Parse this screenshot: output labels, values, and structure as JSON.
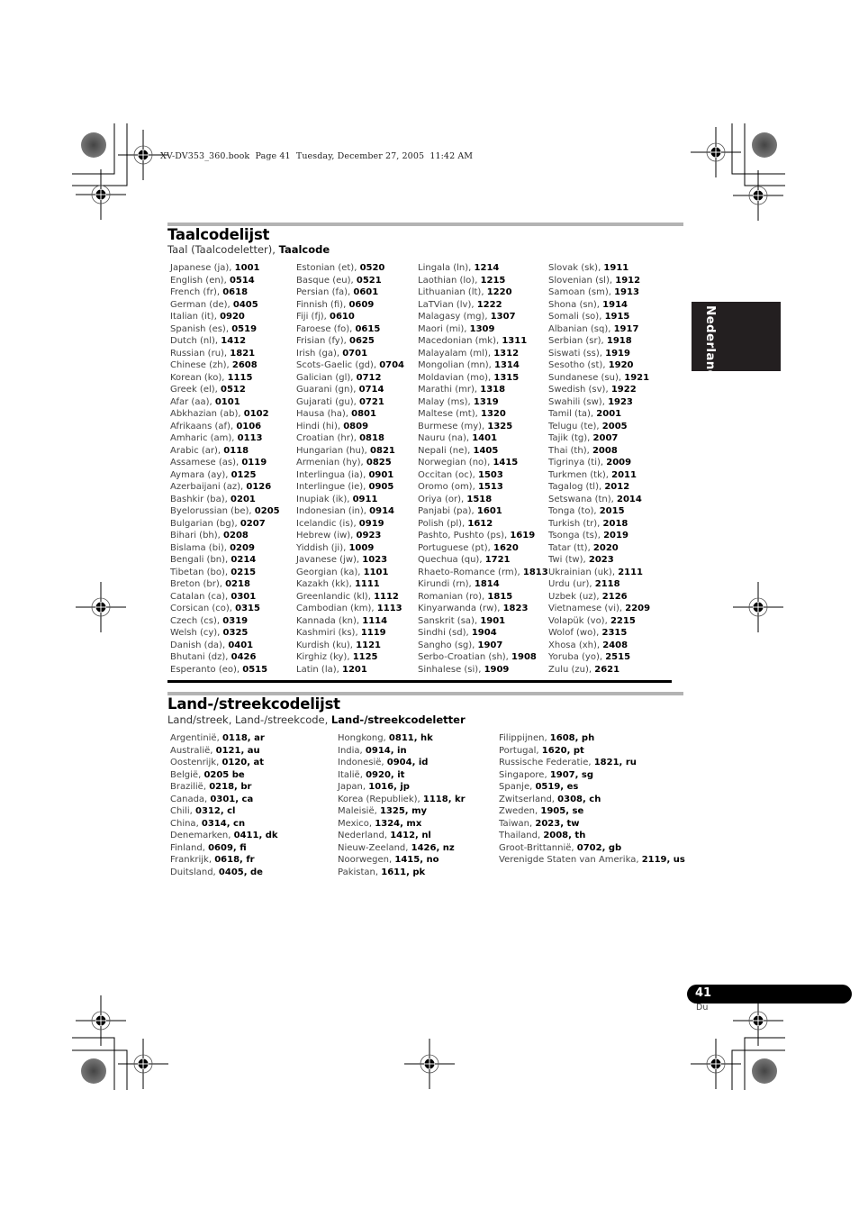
{
  "print_header": "XV-DV353_360.book  Page 41  Tuesday, December 27, 2005  11:42 AM",
  "side_tab": {
    "label": "Nederlands"
  },
  "language_section": {
    "title": "Taalcodelijst",
    "subtitle_plain": "Taal (Taalcodeletter), ",
    "subtitle_bold": "Taalcode",
    "columns": [
      [
        {
          "name": "Japanese (ja), ",
          "code": "1001"
        },
        {
          "name": "English (en), ",
          "code": "0514"
        },
        {
          "name": "French (fr), ",
          "code": "0618"
        },
        {
          "name": "German (de), ",
          "code": "0405"
        },
        {
          "name": "Italian (it), ",
          "code": "0920"
        },
        {
          "name": "Spanish (es), ",
          "code": "0519"
        },
        {
          "name": "Dutch (nl), ",
          "code": "1412"
        },
        {
          "name": "Russian (ru), ",
          "code": "1821"
        },
        {
          "name": "Chinese (zh), ",
          "code": "2608"
        },
        {
          "name": "Korean (ko), ",
          "code": "1115"
        },
        {
          "name": "Greek (el), ",
          "code": "0512"
        },
        {
          "name": "Afar (aa), ",
          "code": "0101"
        },
        {
          "name": "Abkhazian (ab), ",
          "code": "0102"
        },
        {
          "name": "Afrikaans (af), ",
          "code": "0106"
        },
        {
          "name": "Amharic (am), ",
          "code": "0113"
        },
        {
          "name": "Arabic (ar), ",
          "code": "0118"
        },
        {
          "name": "Assamese (as), ",
          "code": "0119"
        },
        {
          "name": "Aymara (ay), ",
          "code": "0125"
        },
        {
          "name": "Azerbaijani (az), ",
          "code": "0126"
        },
        {
          "name": "Bashkir (ba), ",
          "code": "0201"
        },
        {
          "name": "Byelorussian (be), ",
          "code": "0205"
        },
        {
          "name": "Bulgarian (bg), ",
          "code": "0207"
        },
        {
          "name": "Bihari (bh), ",
          "code": "0208"
        },
        {
          "name": "Bislama (bi), ",
          "code": "0209"
        },
        {
          "name": "Bengali (bn), ",
          "code": "0214"
        },
        {
          "name": "Tibetan (bo), ",
          "code": "0215"
        },
        {
          "name": "Breton (br), ",
          "code": "0218"
        },
        {
          "name": "Catalan (ca), ",
          "code": "0301"
        },
        {
          "name": "Corsican (co), ",
          "code": "0315"
        },
        {
          "name": "Czech (cs), ",
          "code": "0319"
        },
        {
          "name": "Welsh (cy), ",
          "code": "0325"
        },
        {
          "name": "Danish (da), ",
          "code": "0401"
        },
        {
          "name": "Bhutani (dz), ",
          "code": "0426"
        },
        {
          "name": "Esperanto (eo), ",
          "code": "0515"
        }
      ],
      [
        {
          "name": "Estonian (et), ",
          "code": "0520"
        },
        {
          "name": "Basque (eu), ",
          "code": "0521"
        },
        {
          "name": "Persian (fa), ",
          "code": "0601"
        },
        {
          "name": "Finnish (fi), ",
          "code": "0609"
        },
        {
          "name": "Fiji (fj), ",
          "code": "0610"
        },
        {
          "name": "Faroese (fo), ",
          "code": "0615"
        },
        {
          "name": "Frisian (fy), ",
          "code": "0625"
        },
        {
          "name": "Irish (ga), ",
          "code": "0701"
        },
        {
          "name": "Scots-Gaelic (gd), ",
          "code": "0704"
        },
        {
          "name": "Galician (gl), ",
          "code": "0712"
        },
        {
          "name": "Guarani (gn), ",
          "code": "0714"
        },
        {
          "name": "Gujarati (gu), ",
          "code": "0721"
        },
        {
          "name": "Hausa (ha), ",
          "code": "0801"
        },
        {
          "name": "Hindi (hi), ",
          "code": "0809"
        },
        {
          "name": "Croatian (hr), ",
          "code": "0818"
        },
        {
          "name": "Hungarian (hu), ",
          "code": "0821"
        },
        {
          "name": "Armenian (hy), ",
          "code": "0825"
        },
        {
          "name": "Interlingua (ia), ",
          "code": "0901"
        },
        {
          "name": "Interlingue (ie), ",
          "code": "0905"
        },
        {
          "name": "Inupiak (ik), ",
          "code": "0911"
        },
        {
          "name": "Indonesian (in), ",
          "code": "0914"
        },
        {
          "name": "Icelandic (is), ",
          "code": "0919"
        },
        {
          "name": "Hebrew (iw), ",
          "code": "0923"
        },
        {
          "name": "Yiddish (ji), ",
          "code": "1009"
        },
        {
          "name": "Javanese (jw), ",
          "code": "1023"
        },
        {
          "name": "Georgian (ka), ",
          "code": "1101"
        },
        {
          "name": "Kazakh (kk), ",
          "code": "1111"
        },
        {
          "name": "Greenlandic (kl), ",
          "code": "1112"
        },
        {
          "name": "Cambodian (km), ",
          "code": "1113"
        },
        {
          "name": "Kannada (kn), ",
          "code": "1114"
        },
        {
          "name": "Kashmiri (ks), ",
          "code": "1119"
        },
        {
          "name": "Kurdish (ku), ",
          "code": "1121"
        },
        {
          "name": "Kirghiz (ky), ",
          "code": "1125"
        },
        {
          "name": "Latin (la), ",
          "code": "1201"
        }
      ],
      [
        {
          "name": "Lingala (ln), ",
          "code": "1214"
        },
        {
          "name": "Laothian (lo), ",
          "code": "1215"
        },
        {
          "name": "Lithuanian (lt), ",
          "code": "1220"
        },
        {
          "name": "LaTVian (lv), ",
          "code": "1222"
        },
        {
          "name": "Malagasy (mg), ",
          "code": "1307"
        },
        {
          "name": "Maori (mi), ",
          "code": "1309"
        },
        {
          "name": "Macedonian (mk), ",
          "code": "1311"
        },
        {
          "name": "Malayalam (ml), ",
          "code": "1312"
        },
        {
          "name": "Mongolian (mn), ",
          "code": "1314"
        },
        {
          "name": "Moldavian (mo), ",
          "code": "1315"
        },
        {
          "name": "Marathi (mr), ",
          "code": "1318"
        },
        {
          "name": "Malay (ms), ",
          "code": "1319"
        },
        {
          "name": "Maltese (mt), ",
          "code": "1320"
        },
        {
          "name": "Burmese (my), ",
          "code": "1325"
        },
        {
          "name": "Nauru (na), ",
          "code": "1401"
        },
        {
          "name": "Nepali (ne), ",
          "code": "1405"
        },
        {
          "name": "Norwegian (no), ",
          "code": "1415"
        },
        {
          "name": "Occitan (oc), ",
          "code": "1503"
        },
        {
          "name": "Oromo (om), ",
          "code": "1513"
        },
        {
          "name": "Oriya (or), ",
          "code": "1518"
        },
        {
          "name": "Panjabi (pa), ",
          "code": "1601"
        },
        {
          "name": "Polish (pl), ",
          "code": "1612"
        },
        {
          "name": "Pashto, Pushto (ps), ",
          "code": "1619"
        },
        {
          "name": "Portuguese (pt), ",
          "code": "1620"
        },
        {
          "name": "Quechua (qu), ",
          "code": "1721"
        },
        {
          "name": "Rhaeto-Romance (rm), ",
          "code": "1813"
        },
        {
          "name": "Kirundi (rn), ",
          "code": "1814"
        },
        {
          "name": "Romanian (ro), ",
          "code": "1815"
        },
        {
          "name": "Kinyarwanda (rw), ",
          "code": "1823"
        },
        {
          "name": "Sanskrit (sa), ",
          "code": "1901"
        },
        {
          "name": "Sindhi (sd), ",
          "code": "1904"
        },
        {
          "name": "Sangho (sg), ",
          "code": "1907"
        },
        {
          "name": "Serbo-Croatian (sh), ",
          "code": "1908"
        },
        {
          "name": "Sinhalese (si), ",
          "code": "1909"
        }
      ],
      [
        {
          "name": "Slovak (sk), ",
          "code": "1911"
        },
        {
          "name": "Slovenian (sl), ",
          "code": "1912"
        },
        {
          "name": "Samoan (sm), ",
          "code": "1913"
        },
        {
          "name": "Shona (sn), ",
          "code": "1914"
        },
        {
          "name": "Somali (so), ",
          "code": "1915"
        },
        {
          "name": "Albanian (sq), ",
          "code": "1917"
        },
        {
          "name": "Serbian (sr), ",
          "code": "1918"
        },
        {
          "name": "Siswati (ss), ",
          "code": "1919"
        },
        {
          "name": "Sesotho (st), ",
          "code": "1920"
        },
        {
          "name": "Sundanese (su), ",
          "code": "1921"
        },
        {
          "name": "Swedish (sv), ",
          "code": "1922"
        },
        {
          "name": "Swahili (sw), ",
          "code": "1923"
        },
        {
          "name": "Tamil (ta), ",
          "code": "2001"
        },
        {
          "name": "Telugu (te), ",
          "code": "2005"
        },
        {
          "name": "Tajik (tg), ",
          "code": "2007"
        },
        {
          "name": "Thai (th), ",
          "code": "2008"
        },
        {
          "name": "Tigrinya (ti), ",
          "code": "2009"
        },
        {
          "name": "Turkmen (tk), ",
          "code": "2011"
        },
        {
          "name": "Tagalog (tl), ",
          "code": "2012"
        },
        {
          "name": "Setswana (tn), ",
          "code": "2014"
        },
        {
          "name": "Tonga (to), ",
          "code": "2015"
        },
        {
          "name": "Turkish (tr), ",
          "code": "2018"
        },
        {
          "name": "Tsonga (ts), ",
          "code": "2019"
        },
        {
          "name": "Tatar (tt), ",
          "code": "2020"
        },
        {
          "name": "Twi (tw), ",
          "code": "2023"
        },
        {
          "name": "Ukrainian (uk), ",
          "code": "2111"
        },
        {
          "name": "Urdu (ur), ",
          "code": "2118"
        },
        {
          "name": "Uzbek (uz), ",
          "code": "2126"
        },
        {
          "name": "Vietnamese (vi), ",
          "code": "2209"
        },
        {
          "name": "Volapük (vo), ",
          "code": "2215"
        },
        {
          "name": "Wolof (wo), ",
          "code": "2315"
        },
        {
          "name": "Xhosa (xh), ",
          "code": "2408"
        },
        {
          "name": "Yoruba (yo), ",
          "code": "2515"
        },
        {
          "name": "Zulu (zu), ",
          "code": "2621"
        }
      ]
    ]
  },
  "country_section": {
    "title": "Land-/streekcodelijst",
    "subtitle_plain": "Land/streek, Land-/streekcode, ",
    "subtitle_bold": "Land-/streekcodeletter",
    "columns": [
      [
        {
          "name": "Argentinië, ",
          "code": "0118, ar"
        },
        {
          "name": "Australië, ",
          "code": "0121, au"
        },
        {
          "name": "Oostenrijk, ",
          "code": "0120, at"
        },
        {
          "name": "België, ",
          "code": "0205 be"
        },
        {
          "name": "Brazilië, ",
          "code": "0218, br"
        },
        {
          "name": "Canada, ",
          "code": "0301, ca"
        },
        {
          "name": "Chili, ",
          "code": "0312, cl"
        },
        {
          "name": "China, ",
          "code": "0314, cn"
        },
        {
          "name": "Denemarken, ",
          "code": "0411, dk"
        },
        {
          "name": "Finland, ",
          "code": "0609, fi"
        },
        {
          "name": "Frankrijk, ",
          "code": "0618, fr"
        },
        {
          "name": "Duitsland, ",
          "code": "0405, de"
        }
      ],
      [
        {
          "name": "Hongkong, ",
          "code": "0811, hk"
        },
        {
          "name": "India, ",
          "code": "0914, in"
        },
        {
          "name": "Indonesië, ",
          "code": "0904, id"
        },
        {
          "name": "Italië, ",
          "code": "0920, it"
        },
        {
          "name": "Japan, ",
          "code": "1016, jp"
        },
        {
          "name": "Korea (Republiek), ",
          "code": "1118, kr"
        },
        {
          "name": "Maleisië, ",
          "code": "1325, my"
        },
        {
          "name": "Mexico, ",
          "code": "1324, mx"
        },
        {
          "name": "Nederland, ",
          "code": "1412, nl"
        },
        {
          "name": "Nieuw-Zeeland, ",
          "code": "1426, nz"
        },
        {
          "name": "Noorwegen, ",
          "code": "1415, no"
        },
        {
          "name": "Pakistan, ",
          "code": "1611, pk"
        }
      ],
      [
        {
          "name": "Filippijnen, ",
          "code": "1608, ph"
        },
        {
          "name": "Portugal, ",
          "code": "1620, pt"
        },
        {
          "name": "Russische Federatie, ",
          "code": "1821, ru"
        },
        {
          "name": "Singapore, ",
          "code": "1907, sg"
        },
        {
          "name": "Spanje, ",
          "code": "0519, es"
        },
        {
          "name": "Zwitserland, ",
          "code": "0308, ch"
        },
        {
          "name": "Zweden, ",
          "code": "1905, se"
        },
        {
          "name": "Taiwan, ",
          "code": "2023, tw"
        },
        {
          "name": "Thailand, ",
          "code": "2008, th"
        },
        {
          "name": "Groot-Brittannië, ",
          "code": "0702, gb"
        },
        {
          "name": "Verenigde Staten van Amerika, ",
          "code": "2119, us"
        }
      ]
    ]
  },
  "footer": {
    "page_number": "41",
    "language_code": "Du"
  }
}
